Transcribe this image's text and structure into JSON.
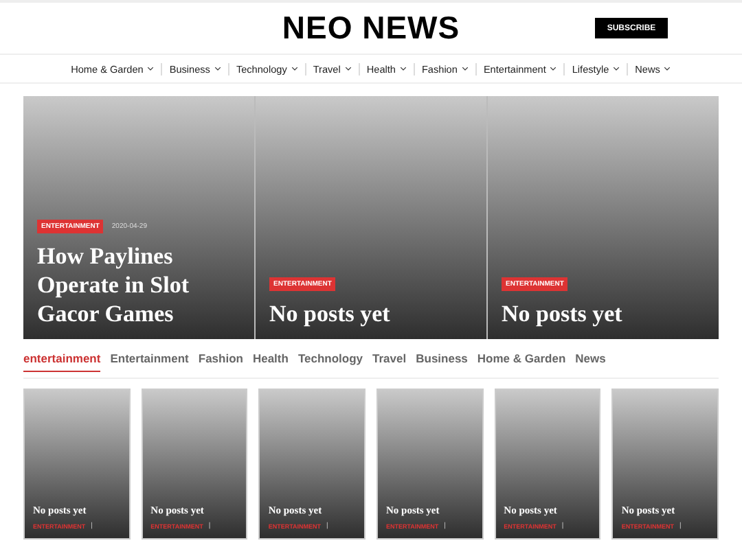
{
  "site": {
    "title": "NEO NEWS",
    "subscribe": "SUBSCRIBE"
  },
  "nav": [
    "Home & Garden",
    "Business",
    "Technology",
    "Travel",
    "Health",
    "Fashion",
    "Entertainment",
    "Lifestyle",
    "News"
  ],
  "hero": [
    {
      "category": "ENTERTAINMENT",
      "date": "2020-04-29",
      "title": "How Paylines Operate in Slot Gacor Games"
    },
    {
      "category": "ENTERTAINMENT",
      "title": "No posts yet"
    },
    {
      "category": "ENTERTAINMENT",
      "title": "No posts yet"
    }
  ],
  "tabs": [
    {
      "label": "entertainment",
      "selected": true
    },
    {
      "label": "Entertainment",
      "selected": false
    },
    {
      "label": "Fashion",
      "selected": false
    },
    {
      "label": "Health",
      "selected": false
    },
    {
      "label": "Technology",
      "selected": false
    },
    {
      "label": "Travel",
      "selected": false
    },
    {
      "label": "Business",
      "selected": false
    },
    {
      "label": "Home & Garden",
      "selected": false
    },
    {
      "label": "News",
      "selected": false
    }
  ],
  "cards": [
    {
      "title": "No posts yet",
      "category": "ENTERTAINMENT",
      "separator": "|"
    },
    {
      "title": "No posts yet",
      "category": "ENTERTAINMENT",
      "separator": "|"
    },
    {
      "title": "No posts yet",
      "category": "ENTERTAINMENT",
      "separator": "|"
    },
    {
      "title": "No posts yet",
      "category": "ENTERTAINMENT",
      "separator": "|"
    },
    {
      "title": "No posts yet",
      "category": "ENTERTAINMENT",
      "separator": "|"
    },
    {
      "title": "No posts yet",
      "category": "ENTERTAINMENT",
      "separator": "|"
    }
  ]
}
